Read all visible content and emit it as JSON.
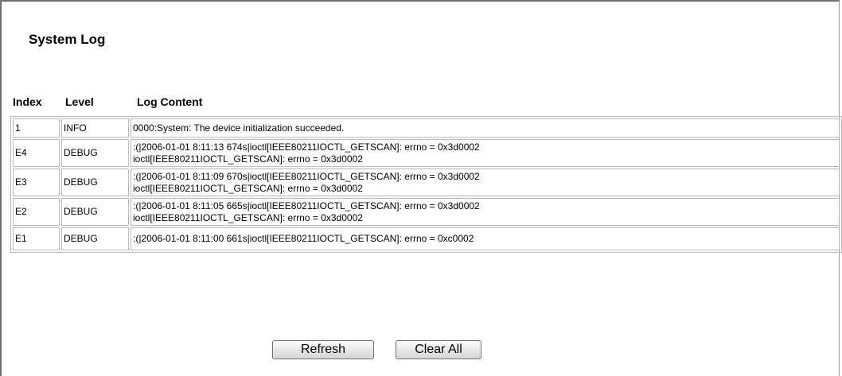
{
  "page": {
    "title": "System Log"
  },
  "columns": {
    "index": "Index",
    "level": "Level",
    "content": "Log Content"
  },
  "rows": [
    {
      "index": "1",
      "level": "INFO",
      "lines": [
        "0000:System: The device initialization succeeded."
      ]
    },
    {
      "index": "E4",
      "level": "DEBUG",
      "lines": [
        ":(|2006-01-01 8:11:13 674s|ioctl[IEEE80211IOCTL_GETSCAN]: errno = 0x3d0002",
        "ioctl[IEEE80211IOCTL_GETSCAN]: errno = 0x3d0002"
      ]
    },
    {
      "index": "E3",
      "level": "DEBUG",
      "lines": [
        ":(|2006-01-01 8:11:09 670s|ioctl[IEEE80211IOCTL_GETSCAN]: errno = 0x3d0002",
        "ioctl[IEEE80211IOCTL_GETSCAN]: errno = 0x3d0002"
      ]
    },
    {
      "index": "E2",
      "level": "DEBUG",
      "lines": [
        ":(|2006-01-01 8:11:05 665s|ioctl[IEEE80211IOCTL_GETSCAN]: errno = 0x3d0002",
        "ioctl[IEEE80211IOCTL_GETSCAN]: errno = 0x3d0002"
      ]
    },
    {
      "index": "E1",
      "level": "DEBUG",
      "lines": [
        ":(|2006-01-01 8:11:00 661s|ioctl[IEEE80211IOCTL_GETSCAN]: errno = 0xc0002"
      ]
    }
  ],
  "buttons": {
    "refresh": "Refresh",
    "clear_all": "Clear All"
  }
}
